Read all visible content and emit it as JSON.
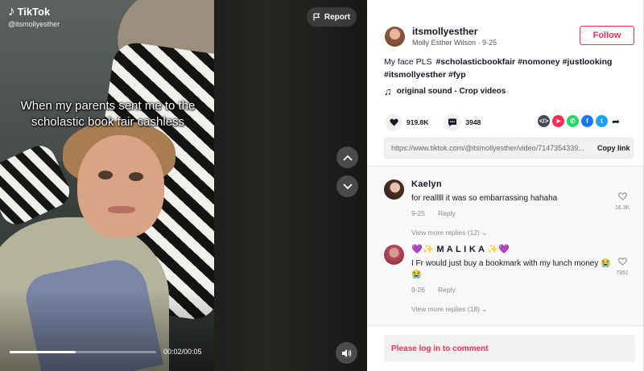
{
  "brand": {
    "name": "TikTok",
    "handle": "@itsmollyesther"
  },
  "video": {
    "caption": "When my parents sent me to the scholastic book fair cashless",
    "report_label": "Report",
    "progress_fraction": 0.45,
    "time": "00:02/00:05",
    "nav_up_icon": "chevron-up-icon",
    "nav_down_icon": "chevron-down-icon",
    "volume_icon": "speaker-icon"
  },
  "author": {
    "username": "itsmollyesther",
    "subtitle": "Molly Esther Wilson · 9-25",
    "follow_label": "Follow"
  },
  "post": {
    "description": "My face PLS",
    "hashtags": [
      "#scholasticbookfair",
      "#nomoney",
      "#justlooking",
      "#itsmollyesther",
      "#fyp"
    ],
    "music": "original sound - Crop videos",
    "likes": "919.8K",
    "comments_count": "3948",
    "share_icons": [
      "embed-icon",
      "telegram-icon",
      "whatsapp-icon",
      "facebook-icon",
      "twitter-icon",
      "share-arrow-icon"
    ],
    "share_colors": [
      "#474a54",
      "#fe2c55",
      "#25d366",
      "#1877f2",
      "#1da1f2"
    ],
    "link_url": "https://www.tiktok.com/@itsmollyesther/video/7147354339...",
    "copy_label": "Copy link"
  },
  "comments": [
    {
      "name": "Kaelyn",
      "text": "for realllll it was so embarrassing hahaha",
      "date": "9-25",
      "reply_label": "Reply",
      "replies_label": "View more replies (12)",
      "likes": "16.3K"
    },
    {
      "name": "💜✨ M A L I K A ✨💜",
      "text": "I Fr would just buy a bookmark with my lunch money 😭😭",
      "date": "9-26",
      "reply_label": "Reply",
      "replies_label": "View more replies (18)",
      "likes": "7951"
    }
  ],
  "login_prompt": "Please log in to comment"
}
